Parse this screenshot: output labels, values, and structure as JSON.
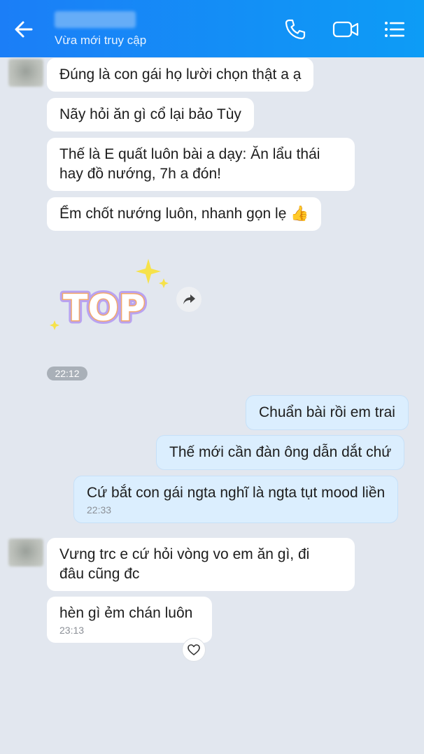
{
  "header": {
    "status": "Vừa mới truy cập",
    "back_icon": "arrow-left-icon",
    "call_icon": "phone-icon",
    "video_icon": "video-camera-icon",
    "menu_icon": "list-menu-icon",
    "gradient": [
      "#1b7ef7",
      "#0d9cf6"
    ]
  },
  "messages": [
    {
      "from": "contact",
      "text": "Đúng là con gái họ lười chọn thật a ạ"
    },
    {
      "from": "contact",
      "text": "Nãy hỏi ăn gì cổ lại bảo Tùy"
    },
    {
      "from": "contact",
      "text": "Thế là E quất luôn bài a dạy: Ăn lẩu thái",
      "text2": "hay đồ nướng, 7h a đón!"
    },
    {
      "from": "contact",
      "text": "Ểm chốt nướng luôn, nhanh gọn lẹ 👍"
    },
    {
      "from": "contact",
      "type": "sticker",
      "sticker_text": "TOP"
    },
    {
      "from": "me",
      "text": "Chuẩn bài rồi em trai"
    },
    {
      "from": "me",
      "text": "Thế mới cần đàn ông dẫn dắt chứ"
    },
    {
      "from": "me",
      "text": "Cứ bắt con gái ngta nghĩ là ngta tụt mood liền",
      "time": "22:33"
    },
    {
      "from": "contact",
      "text": "Vưng trc e cứ hỏi vòng vo em ăn gì, đi",
      "text2": "đâu cũng đc"
    },
    {
      "from": "contact",
      "text": "hèn gì ẻm chán luôn",
      "time": "23:13"
    }
  ],
  "time_divider": "22:12",
  "colors": {
    "background": "#e2e7ef",
    "incoming_bubble": "#ffffff",
    "outgoing_bubble": "#dbeefe"
  }
}
